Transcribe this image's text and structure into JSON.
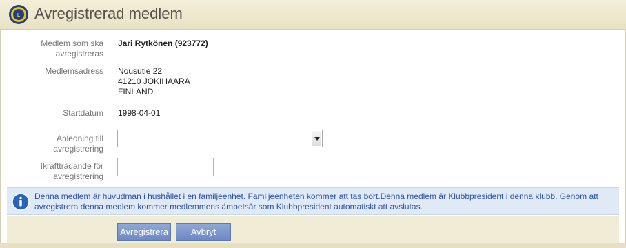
{
  "header": {
    "title": "Avregistrerad medlem",
    "logo": "lions-club-logo"
  },
  "form": {
    "member": {
      "label": "Medlem som ska avregistreras",
      "value": "Jari Rytkönen (923772)"
    },
    "address": {
      "label": "Medlemsadress",
      "lines": [
        "Nousutie 22",
        "41210 JOKIHAARA",
        "FINLAND"
      ]
    },
    "start_date": {
      "label": "Startdatum",
      "value": "1998-04-01"
    },
    "reason": {
      "label": "Anledning till avregistrering",
      "value": ""
    },
    "effective_date": {
      "label": "Ikraftträdande för avregistrering",
      "value": ""
    }
  },
  "info_message": "Denna medlem är huvudman i hushållet i en familjeenhet. Familjeenheten kommer att tas bort.Denna medlem är Klubbpresident i denna klubb. Genom att avregistrera denna medlem kommer medlemmens ämbetsår som Klubbpresident automatiskt att avslutas.",
  "buttons": {
    "submit_label": "Avregistrera",
    "cancel_label": "Avbryt"
  },
  "colors": {
    "header_bg": "#ede7cc",
    "info_bg": "#dfeaf6",
    "info_text": "#2d4fb0",
    "button": "#7a93cc"
  }
}
